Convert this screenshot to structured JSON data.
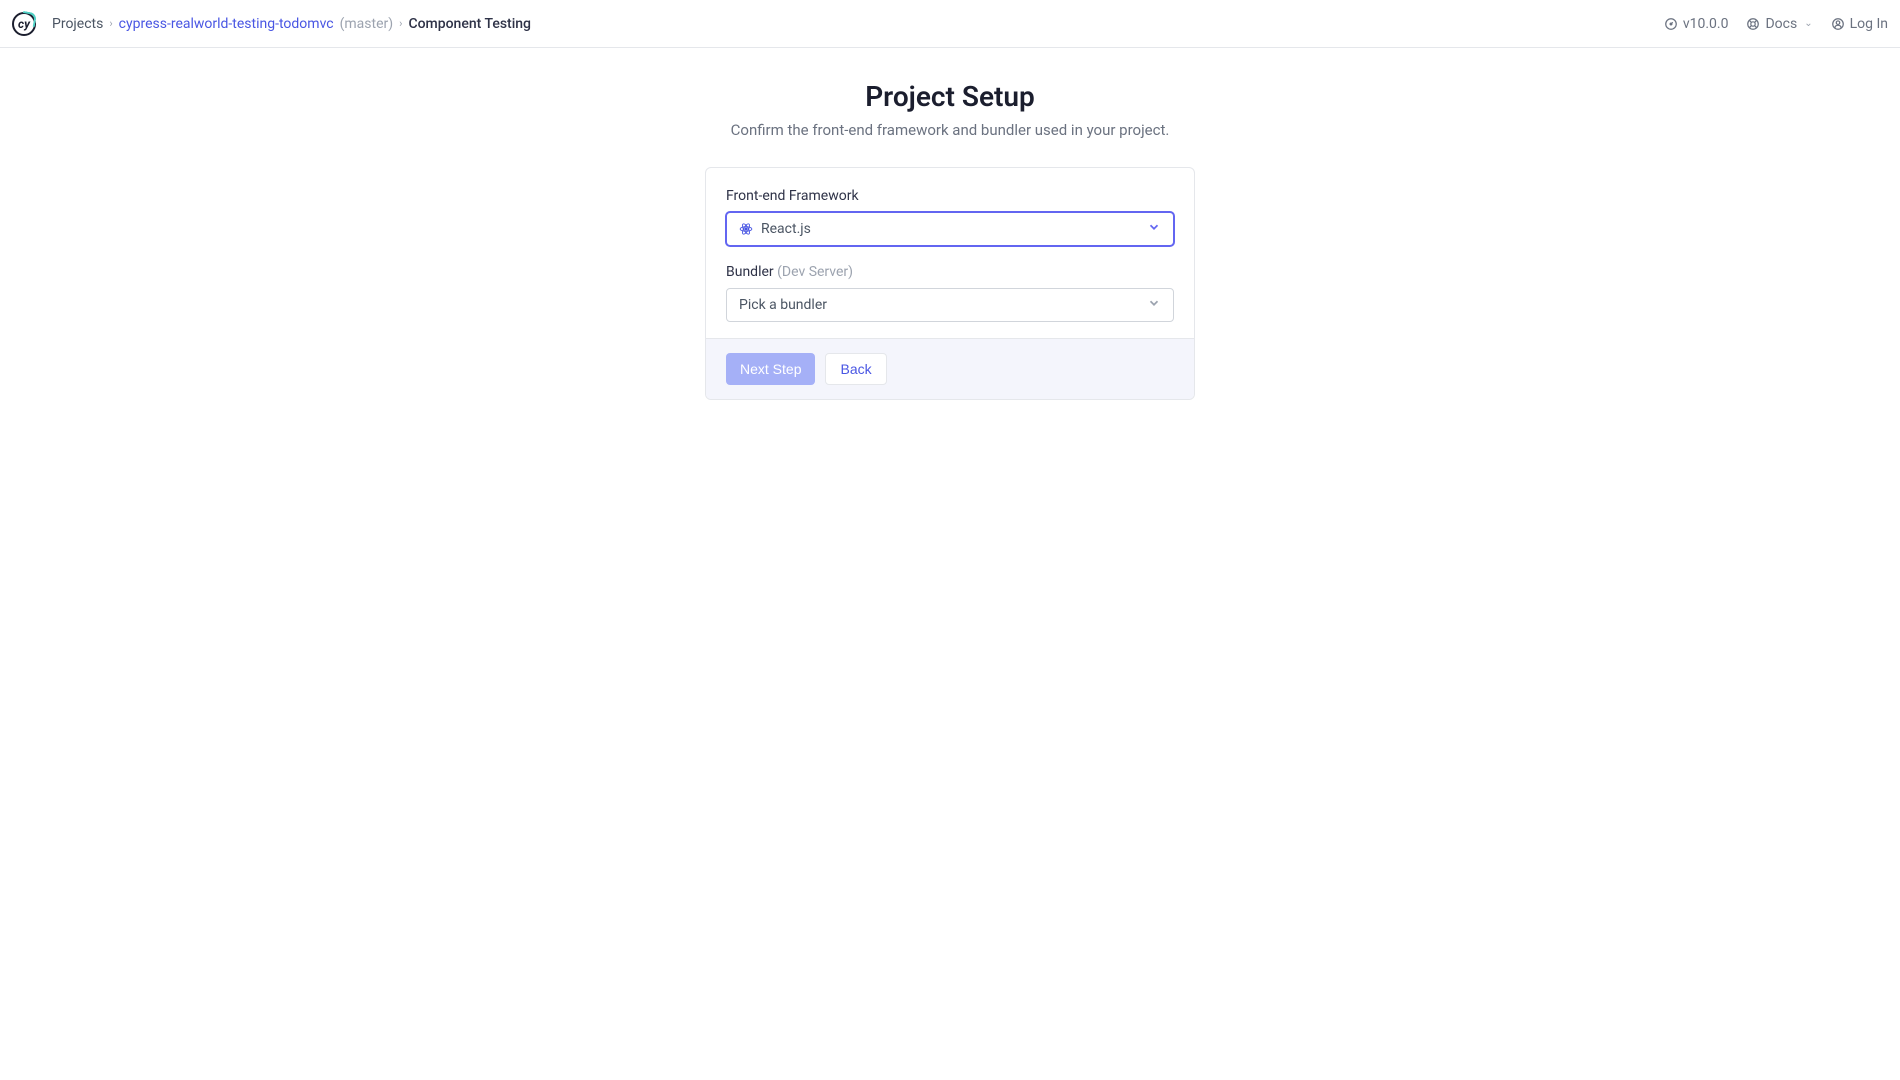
{
  "header": {
    "breadcrumb": {
      "projects": "Projects",
      "project": "cypress-realworld-testing-todomvc",
      "branch": "(master)",
      "current": "Component Testing"
    },
    "version": "v10.0.0",
    "docs": "Docs",
    "login": "Log In"
  },
  "main": {
    "title": "Project Setup",
    "subtitle": "Confirm the front-end framework and bundler used in your project.",
    "framework": {
      "label": "Front-end Framework",
      "selected": "React.js"
    },
    "bundler": {
      "label": "Bundler",
      "hint": "(Dev Server)",
      "placeholder": "Pick a bundler"
    },
    "next": "Next Step",
    "back": "Back"
  }
}
